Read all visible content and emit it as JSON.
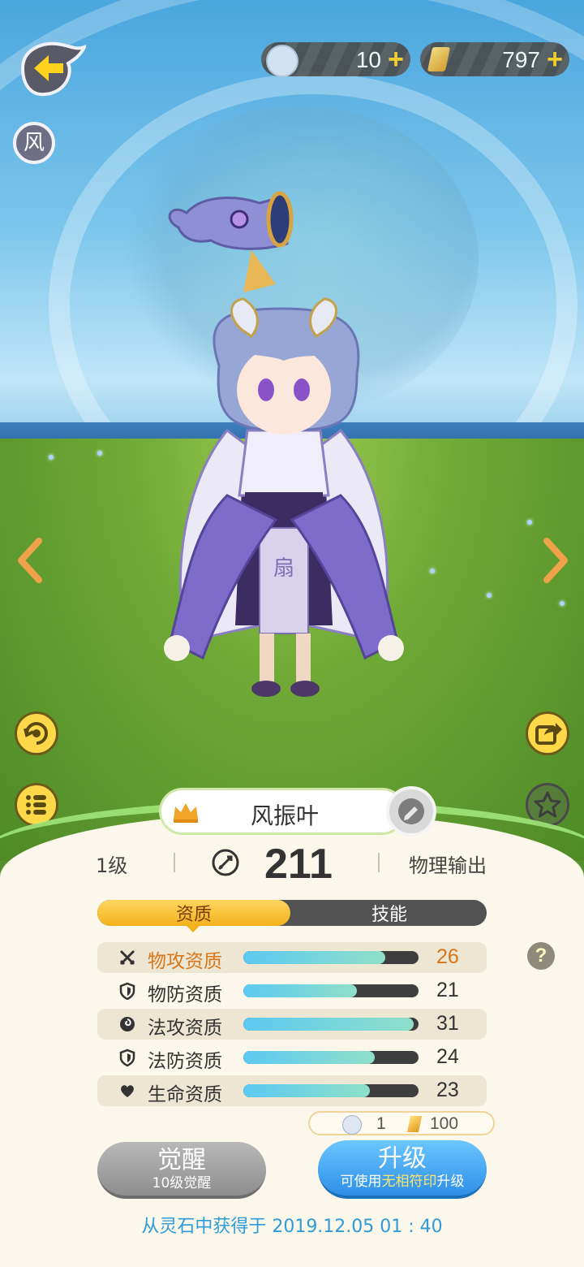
{
  "resources": {
    "tickets": "10",
    "gems": "797",
    "plus": "+"
  },
  "element_badge": "风",
  "character": {
    "name": "风振叶",
    "level": "1级",
    "power": "211",
    "role": "物理输出"
  },
  "tabs": [
    "资质",
    "技能"
  ],
  "aptitudes": [
    {
      "label": "物攻资质",
      "value": "26",
      "ratio": 0.81,
      "icon": "crossed-swords-icon",
      "highlight": true
    },
    {
      "label": "物防资质",
      "value": "21",
      "ratio": 0.65,
      "icon": "shield-icon",
      "highlight": false
    },
    {
      "label": "法攻资质",
      "value": "31",
      "ratio": 0.97,
      "icon": "swirl-icon",
      "highlight": false
    },
    {
      "label": "法防资质",
      "value": "24",
      "ratio": 0.75,
      "icon": "shield-icon",
      "highlight": false
    },
    {
      "label": "生命资质",
      "value": "23",
      "ratio": 0.72,
      "icon": "heart-icon",
      "highlight": false
    }
  ],
  "help_mark": "?",
  "cost": {
    "tickets": "1",
    "gems": "100"
  },
  "buttons": {
    "awaken": {
      "label": "觉醒",
      "sub": "10级觉醒"
    },
    "upgrade": {
      "label": "升级",
      "sub_prefix": "可使用",
      "sub_item": "无相符印",
      "sub_suffix": "升级"
    }
  },
  "obtained_note": "从灵石中获得于 2019.12.05   01 : 40",
  "colors": {
    "accent_yellow": "#f3b21c",
    "highlight_orange": "#d9761a",
    "upgrade_blue": "#2d8fe8",
    "note_blue": "#2f9bd8"
  }
}
